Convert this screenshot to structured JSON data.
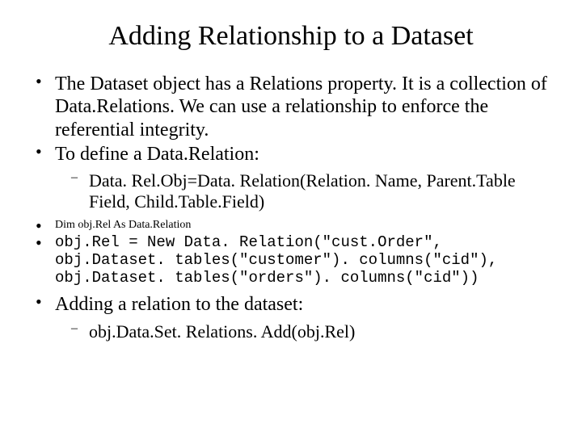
{
  "title": "Adding Relationship to a Dataset",
  "bullets": {
    "b1": "The Dataset object has a Relations property.  It is a collection of Data.Relations.  We can use a relationship to enforce the referential integrity.",
    "b2": "To define a Data.Relation:",
    "b2_sub1": "Data. Rel.Obj=Data. Relation(Relation. Name, Parent.Table Field, Child.Table.Field)",
    "b3": "Dim obj.Rel As Data.Relation",
    "b4": "obj.Rel = New Data. Relation(\"cust.Order\", obj.Dataset. tables(\"customer\"). columns(\"cid\"), obj.Dataset. tables(\"orders\"). columns(\"cid\"))",
    "b5": "Adding a relation to the dataset:",
    "b5_sub1": "obj.Data.Set. Relations. Add(obj.Rel)"
  }
}
